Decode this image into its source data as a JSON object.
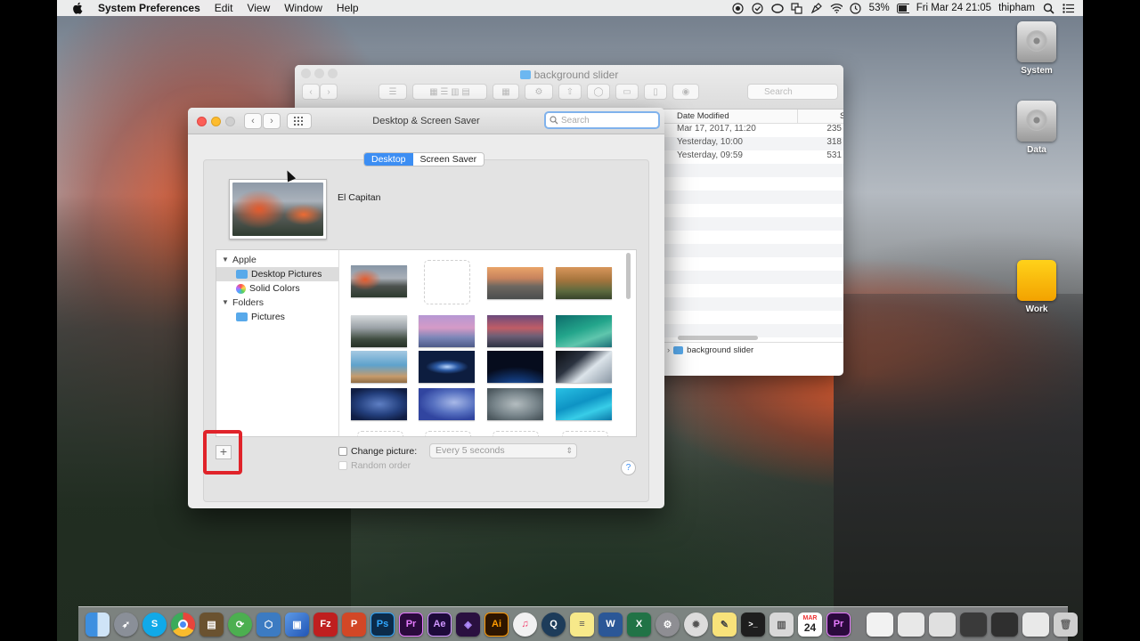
{
  "menubar": {
    "app_name": "System Preferences",
    "menus": [
      "Edit",
      "View",
      "Window",
      "Help"
    ],
    "battery": "53%",
    "clock": "Fri Mar 24  21:05",
    "user": "thipham"
  },
  "desktop": {
    "drives": [
      "System",
      "Data",
      "Work"
    ]
  },
  "finder": {
    "title": "background slider",
    "search_placeholder": "Search",
    "column_date": "Date Modified",
    "rows": [
      {
        "date": "Mar 17, 2017, 11:20",
        "size": "235"
      },
      {
        "date": "Yesterday, 10:00",
        "size": "318"
      },
      {
        "date": "Yesterday, 09:59",
        "size": "531"
      }
    ],
    "path": "background slider"
  },
  "prefs": {
    "title": "Desktop & Screen Saver",
    "search_placeholder": "Search",
    "tabs": [
      "Desktop",
      "Screen Saver"
    ],
    "current_picture": "El Capitan",
    "sidebar": {
      "group_apple": "Apple",
      "desktop_pictures": "Desktop Pictures",
      "solid_colors": "Solid Colors",
      "group_folders": "Folders",
      "pictures": "Pictures"
    },
    "add_button": "+",
    "change_picture_label": "Change picture:",
    "interval": "Every 5 seconds",
    "random_order": "Random order",
    "help": "?"
  },
  "dock": {
    "calendar_month": "MAR",
    "calendar_day": "24"
  },
  "colors": {
    "accent": "#3c8ef3",
    "highlight_red": "#e0232a"
  }
}
